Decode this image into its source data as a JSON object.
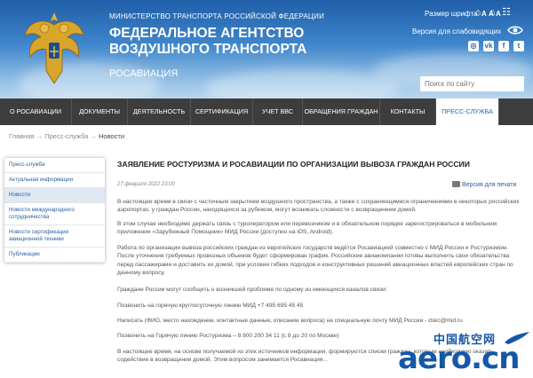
{
  "header": {
    "ministry": "МИНИСТЕРСТВО ТРАНСПОРТА РОССИЙСКОЙ ФЕДЕРАЦИИ",
    "agency_line1": "ФЕДЕРАЛЬНОЕ АГЕНТСТВО",
    "agency_line2": "ВОЗДУШНОГО ТРАНСПОРТА",
    "short_name": "РОСАВИАЦИЯ",
    "font_size_label": "Размер шрифта:",
    "font_size_options": "А А А",
    "visually_impaired": "Версия для слабовидящих",
    "search_placeholder": "Поиск по сайту",
    "social": [
      "instagram",
      "vk",
      "facebook",
      "twitter"
    ]
  },
  "nav": {
    "items": [
      {
        "label": "О Росавиации",
        "w": 0
      },
      {
        "label": "Документы"
      },
      {
        "label": "Деятельность"
      },
      {
        "label": "Сертификация"
      },
      {
        "label": "Учет ВВС"
      },
      {
        "label": "Обращения граждан"
      },
      {
        "label": "Контакты"
      },
      {
        "label": "Пресс-служба"
      }
    ],
    "active": "Пресс-служба"
  },
  "breadcrumb": {
    "home": "Главная",
    "sep": "→",
    "section": "Пресс-служба",
    "current": "Новости"
  },
  "sidebar": {
    "items": [
      "Пресс-служба",
      "Актуальная информация",
      "Новости",
      "Новости международного сотрудничества",
      "Новости сертификации авиационной техники",
      "Публикации"
    ],
    "active": "Новости"
  },
  "article": {
    "title": "Заявление Ростуризма и Росавиации по организации вывоза граждан России",
    "date": "27 февраля 2022 23:00",
    "print_label": "Версия для печати",
    "paragraphs": [
      "В настоящее время в связи с частичным закрытием воздушного пространства, а также с сохраняющимися ограничениями в некоторых российских аэропортах, у граждан России, находящихся за рубежом, могут возникать сложности с возвращением домой.",
      "В этом случае необходимо держать связь с туроператором или перевозчиком и в обязательном порядке зарегистрироваться в мобильном приложении «Зарубежный Помощник» МИД России (доступно на iOS, Android).",
      "Работа по организации вывоза российских граждан из европейских государств ведётся Росавиацией совместно с МИД России и Ростуризмом. После уточнения требуемых провозных объемов будет сформирован график. Российские авиакомпании готовы выполнить свои обязательства перед пассажирами и доставить их домой, при условии гибких подходов и конструктивных решений авиационных властей европейских стран по данному вопросу.",
      "Граждане России могут сообщить о возникшей проблеме по одному из имеющихся каналов связи:",
      "Позвонить на горячую круглосуточную линию МИД +7 495 695 45 45",
      "Написать (ФИО, место нахождение, контактные данные, описание вопроса) на специальную почту МИД России - dskc@mid.ru",
      "Позвонить на Горячую линию Ростуризма – 8 800 200 34 11 (с 8 до 20 по Москве)",
      "В настоящее время, на основе получаемой из этих источников информации, формируются списки граждан, которым необходимо оказать содействие в возвращении домой. Этим вопросом занимается Росавиация..."
    ]
  },
  "watermark": {
    "cn": "中国航空网",
    "main": "aero.cn"
  }
}
